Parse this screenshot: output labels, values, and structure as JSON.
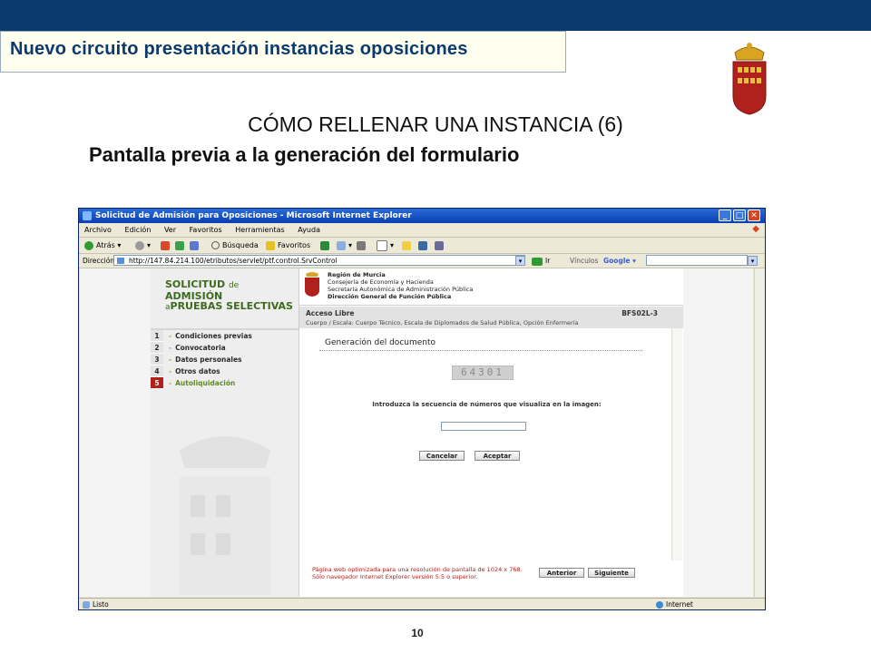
{
  "slide": {
    "header_title": "Nuevo circuito presentación instancias oposiciones",
    "heading": "CÓMO RELLENAR UNA INSTANCIA (6)",
    "subheading": "Pantalla previa a la generación del formulario",
    "page_number": "10",
    "colors": {
      "top_bar": "#0b3a6e",
      "crest_red": "#b0201c"
    }
  },
  "browser": {
    "window_title": "Solicitud de Admisión para Oposiciones - Microsoft Internet Explorer",
    "menu": [
      "Archivo",
      "Edición",
      "Ver",
      "Favoritos",
      "Herramientas",
      "Ayuda"
    ],
    "toolbar": {
      "back": "Atrás",
      "search": "Búsqueda",
      "favorites": "Favoritos"
    },
    "address_label": "Dirección",
    "address": "http://147.84.214.100/etributos/servlet/ptf.control.SrvControl",
    "go": "Ir",
    "links": "Vínculos",
    "google": "Google",
    "status_left": "Listo",
    "status_zone": "Internet"
  },
  "page": {
    "logo": {
      "line1a": "SOLICITUD",
      "line1b": "de",
      "line1c": "ADMISIÓN",
      "line2a": "a",
      "line2b": "PRUEBAS SELECTIVAS"
    },
    "org": [
      "Región de Murcia",
      "Consejería de Economía y Hacienda",
      "Secretaría Autonómica de Administración Pública",
      "Dirección General de Función Pública"
    ],
    "access": "Acceso Libre",
    "code": "BFS02L-3",
    "body_line": "Cuerpo / Escala: Cuerpo Técnico, Escala de Diplomados de Salud Pública, Opción Enfermería",
    "menu": [
      {
        "num": "1",
        "label": "Condiciones previas"
      },
      {
        "num": "2",
        "label": "Convocatoria"
      },
      {
        "num": "3",
        "label": "Datos personales"
      },
      {
        "num": "4",
        "label": "Otros datos"
      },
      {
        "num": "5",
        "label": "Autoliquidación",
        "active": true
      }
    ],
    "section_title": "Generación del documento",
    "captcha": "64301",
    "prompt": "Introduzca la secuencia de números que visualiza en la imagen:",
    "input_value": "",
    "cancel": "Cancelar",
    "accept": "Aceptar",
    "note_line1": "Página web optimizada para una resolución de pantalla de 1024 x 768.",
    "note_line2": "Sólo navegador Internet Explorer versión 5.5 o superior.",
    "previous": "Anterior",
    "next": "Siguiente"
  }
}
